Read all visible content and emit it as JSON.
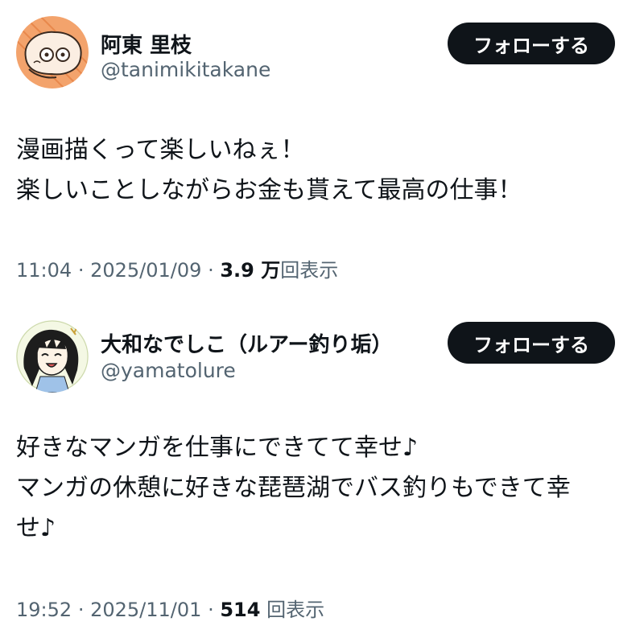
{
  "tweets": [
    {
      "display_name": "阿東 里枝",
      "handle": "@tanimikitakane",
      "follow_label": "フォローする",
      "body_lines": [
        "漫画描くって楽しいねぇ！",
        "楽しいことしながらお金も貰えて最高の仕事！"
      ],
      "time": "11:04",
      "date": "2025/01/09",
      "separator": "·",
      "views_count": "3.9 万",
      "views_label": "回表示",
      "avatar_icon": "cartoon-face-avatar-icon"
    },
    {
      "display_name": "大和なでしこ（ルアー釣り垢）",
      "handle": "@yamatolure",
      "follow_label": "フォローする",
      "body_lines": [
        "好きなマンガを仕事にできてて幸せ♪",
        "マンガの休憩に好きな琵琶湖でバス釣りもできて幸",
        "せ♪"
      ],
      "time": "19:52",
      "date": "2025/11/01",
      "separator": "·",
      "views_count": "514",
      "views_label": "回表示",
      "avatar_icon": "anime-girl-avatar-icon"
    }
  ],
  "colors": {
    "text_primary": "#0f1419",
    "text_secondary": "#536471",
    "button_bg": "#0f1419",
    "button_text": "#ffffff",
    "avatar1_bg": "#f3a36c"
  }
}
